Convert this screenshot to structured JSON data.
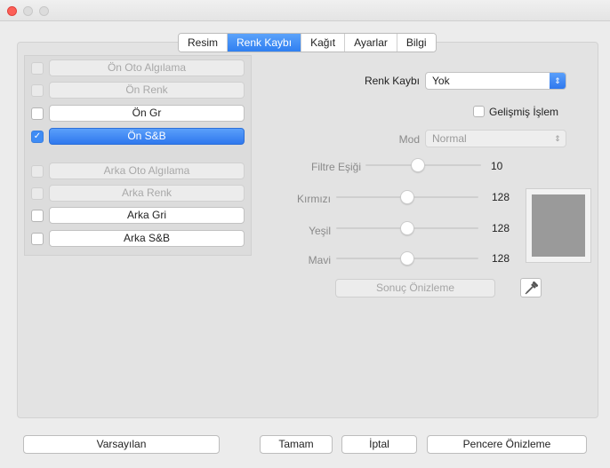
{
  "window": {
    "controls": [
      "close-icon",
      "minimize-icon",
      "zoom-icon"
    ],
    "colors": {
      "close": "#fc5f57",
      "accent": "#2f7ff1"
    }
  },
  "tabs": [
    {
      "label": "Resim",
      "active": false
    },
    {
      "label": "Renk Kaybı",
      "active": true
    },
    {
      "label": "Kağıt",
      "active": false
    },
    {
      "label": "Ayarlar",
      "active": false
    },
    {
      "label": "Bilgi",
      "active": false
    }
  ],
  "front": {
    "auto_detect": {
      "label": "Ön Oto Algılama",
      "checked": false,
      "enabled": false
    },
    "color": {
      "label": "Ön Renk",
      "checked": false,
      "enabled": false
    },
    "gray": {
      "label": "Ön Gr",
      "checked": false,
      "enabled": true
    },
    "bw": {
      "label": "Ön S&B",
      "checked": true,
      "enabled": true,
      "selected": true
    }
  },
  "back": {
    "auto_detect": {
      "label": "Arka Oto Algılama",
      "checked": false,
      "enabled": false
    },
    "color": {
      "label": "Arka Renk",
      "checked": false,
      "enabled": false
    },
    "gray": {
      "label": "Arka Gri",
      "checked": false,
      "enabled": true
    },
    "bw": {
      "label": "Arka S&B",
      "checked": false,
      "enabled": true
    }
  },
  "dropout": {
    "label": "Renk Kaybı",
    "value": "Yok",
    "advanced_label": "Gelişmiş İşlem",
    "advanced_checked": false,
    "mode_label": "Mod",
    "mode_value": "Normal",
    "threshold_label": "Filtre Eşiği",
    "threshold_value": "10",
    "threshold_level": 0.45,
    "red_label": "Kırmızı",
    "red_value": "128",
    "green_label": "Yeşil",
    "green_value": "128",
    "blue_label": "Mavi",
    "blue_value": "128",
    "channel_level": 0.5,
    "preview_button": "Sonuç Önizleme",
    "preview_color": "#9a9a9a",
    "picker_icon": "eyedropper-icon"
  },
  "footer": {
    "defaults": "Varsayılan",
    "ok": "Tamam",
    "cancel": "İptal",
    "window_preview": "Pencere Önizleme"
  }
}
